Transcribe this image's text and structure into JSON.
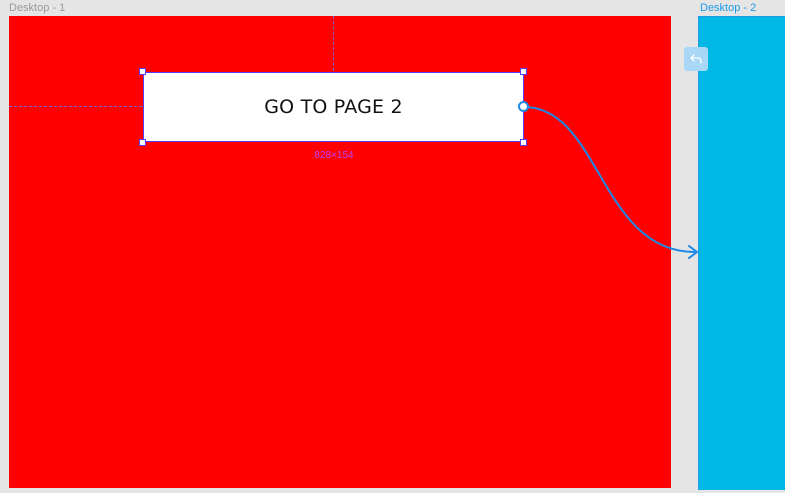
{
  "frames": [
    {
      "label": "Desktop - 1",
      "color": "#ff0000"
    },
    {
      "label": "Desktop - 2",
      "color": "#00b8e6"
    }
  ],
  "selection": {
    "button_text": "GO TO PAGE 2",
    "size_label": "828×154",
    "outline_color": "#5b3cf5"
  },
  "prototype": {
    "connector_color": "#1e88e5",
    "back_icon": "reply-arrow-icon"
  }
}
